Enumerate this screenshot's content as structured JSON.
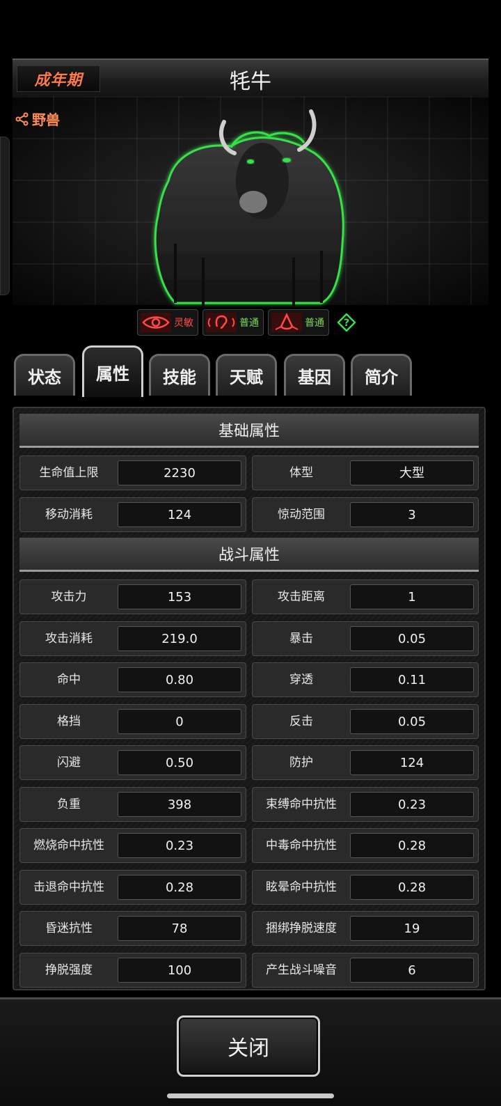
{
  "header": {
    "stage": "成年期",
    "title": "牦牛"
  },
  "category": {
    "icon": "share-icon",
    "label": "野兽"
  },
  "senses": [
    {
      "icon": "eye-icon",
      "label": "灵敏",
      "color": "#ff4a4a"
    },
    {
      "icon": "ear-icon",
      "label": "普通",
      "color": "#7ed957"
    },
    {
      "icon": "nose-icon",
      "label": "普通",
      "color": "#7ed957"
    }
  ],
  "help_icon": "question-icon",
  "tabs": [
    {
      "label": "状态",
      "active": false
    },
    {
      "label": "属性",
      "active": true
    },
    {
      "label": "技能",
      "active": false
    },
    {
      "label": "天赋",
      "active": false
    },
    {
      "label": "基因",
      "active": false
    },
    {
      "label": "简介",
      "active": false
    }
  ],
  "basic": {
    "title": "基础属性",
    "rows": [
      [
        {
          "label": "生命值上限",
          "value": "2230"
        },
        {
          "label": "体型",
          "value": "大型"
        }
      ],
      [
        {
          "label": "移动消耗",
          "value": "124"
        },
        {
          "label": "惊动范围",
          "value": "3"
        }
      ]
    ]
  },
  "combat": {
    "title": "战斗属性",
    "rows": [
      [
        {
          "label": "攻击力",
          "value": "153"
        },
        {
          "label": "攻击距离",
          "value": "1"
        }
      ],
      [
        {
          "label": "攻击消耗",
          "value": "219.0"
        },
        {
          "label": "暴击",
          "value": "0.05"
        }
      ],
      [
        {
          "label": "命中",
          "value": "0.80"
        },
        {
          "label": "穿透",
          "value": "0.11"
        }
      ],
      [
        {
          "label": "格挡",
          "value": "0"
        },
        {
          "label": "反击",
          "value": "0.05"
        }
      ],
      [
        {
          "label": "闪避",
          "value": "0.50"
        },
        {
          "label": "防护",
          "value": "124"
        }
      ],
      [
        {
          "label": "负重",
          "value": "398"
        },
        {
          "label": "束缚命中抗性",
          "value": "0.23"
        }
      ],
      [
        {
          "label": "燃烧命中抗性",
          "value": "0.23"
        },
        {
          "label": "中毒命中抗性",
          "value": "0.28"
        }
      ],
      [
        {
          "label": "击退命中抗性",
          "value": "0.28"
        },
        {
          "label": "眩晕命中抗性",
          "value": "0.28"
        }
      ],
      [
        {
          "label": "昏迷抗性",
          "value": "78"
        },
        {
          "label": "捆绑挣脱速度",
          "value": "19"
        }
      ],
      [
        {
          "label": "挣脱强度",
          "value": "100"
        },
        {
          "label": "产生战斗噪音",
          "value": "6"
        }
      ]
    ]
  },
  "footer": {
    "close_label": "关闭"
  }
}
